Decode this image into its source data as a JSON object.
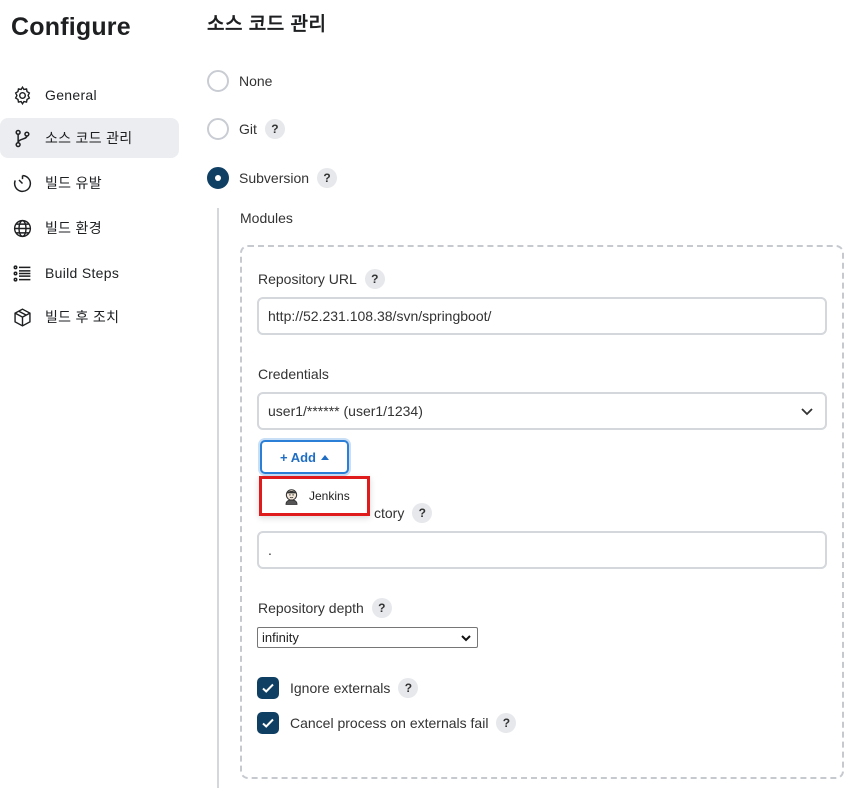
{
  "sidebar": {
    "title": "Configure",
    "items": [
      {
        "label": "General",
        "icon": "gear-icon"
      },
      {
        "label": "소스 코드 관리",
        "icon": "branch-icon",
        "active": true
      },
      {
        "label": "빌드 유발",
        "icon": "timer-icon"
      },
      {
        "label": "빌드 환경",
        "icon": "globe-icon"
      },
      {
        "label": "Build Steps",
        "icon": "list-icon"
      },
      {
        "label": "빌드 후 조치",
        "icon": "package-icon"
      }
    ]
  },
  "section": {
    "title": "소스 코드 관리",
    "options": [
      {
        "label": "None",
        "checked": false,
        "help": false
      },
      {
        "label": "Git",
        "checked": false,
        "help": true
      },
      {
        "label": "Subversion",
        "checked": true,
        "help": true
      }
    ]
  },
  "modules": {
    "label": "Modules",
    "repository_url": {
      "label": "Repository URL",
      "value": "http://52.231.108.38/svn/springboot/"
    },
    "credentials": {
      "label": "Credentials",
      "value": "user1/****** (user1/1234)"
    },
    "add_button": {
      "label": "+ Add"
    },
    "add_menu": {
      "items": [
        "Jenkins"
      ]
    },
    "local_dir": {
      "label_visible": "ctory",
      "value": "."
    },
    "depth": {
      "label": "Repository depth",
      "value": "infinity"
    },
    "ignore_externals": {
      "label": "Ignore externals",
      "checked": true
    },
    "cancel_process": {
      "label": "Cancel process on externals fail",
      "checked": true
    }
  },
  "help_symbol": "?",
  "colors": {
    "accent": "#0f3f63",
    "link_blue": "#1f6ec4",
    "highlight_red": "#e01b1b"
  }
}
